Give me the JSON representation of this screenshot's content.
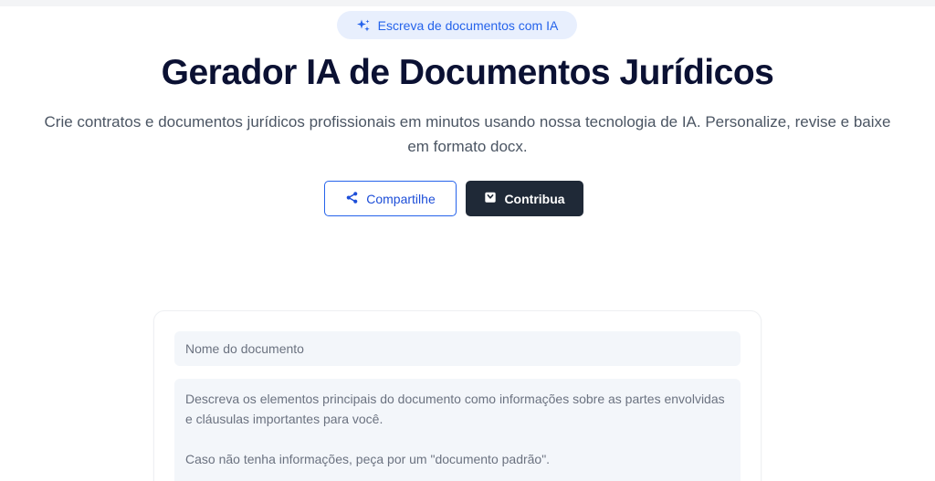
{
  "badge": {
    "icon": "sparkles-icon",
    "label": "Escreva de documentos com IA"
  },
  "hero": {
    "title": "Gerador IA de Documentos Jurídicos",
    "subtitle": "Crie contratos e documentos jurídicos profissionais em minutos usando nossa tecnologia de IA. Personalize, revise e baixe em formato docx."
  },
  "actions": {
    "share_label": "Compartilhe",
    "share_icon": "share-icon",
    "contribute_label": "Contribua",
    "contribute_icon": "gift-icon"
  },
  "form": {
    "name_placeholder": "Nome do documento",
    "name_value": "",
    "description_placeholder": "Descreva os elementos principais do documento como informações sobre as partes envolvidas e cláusulas importantes para você.\n\nCaso não tenha informações, peça por um \"documento padrão\".",
    "description_value": ""
  },
  "colors": {
    "accent": "#2563eb",
    "title": "#0b1133",
    "dark_button": "#1f2937",
    "badge_bg": "#e8effd",
    "field_bg": "#f3f6fa"
  }
}
